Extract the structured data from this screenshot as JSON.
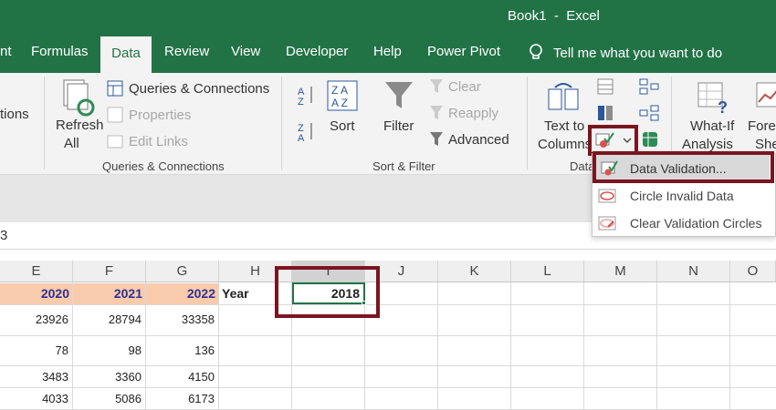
{
  "app": {
    "title": "Book1  -  Excel"
  },
  "tabs": [
    {
      "label": "nt"
    },
    {
      "label": "Formulas"
    },
    {
      "label": "Data"
    },
    {
      "label": "Review"
    },
    {
      "label": "View"
    },
    {
      "label": "Developer"
    },
    {
      "label": "Help"
    },
    {
      "label": "Power Pivot"
    }
  ],
  "tell_me": "Tell me what you want to do",
  "ribbon": {
    "left_cut": "tions",
    "refresh": {
      "line1": "Refresh",
      "line2": "All"
    },
    "queries_connections": "Queries & Connections",
    "properties": "Properties",
    "edit_links": "Edit Links",
    "group_queries": "Queries & Connections",
    "sort": "Sort",
    "filter": "Filter",
    "clear": "Clear",
    "reapply": "Reapply",
    "advanced": "Advanced",
    "group_sort_filter": "Sort & Filter",
    "text_to_columns": {
      "line1": "Text to",
      "line2": "Columns"
    },
    "group_data_tools": "Data",
    "whatif": {
      "line1": "What-If",
      "line2": "Analysis"
    },
    "forecast": {
      "line1": "Forec",
      "line2": "She"
    }
  },
  "menu": {
    "items": [
      {
        "label": "Data Validation...",
        "highlighted": true,
        "enabled": true
      },
      {
        "label": "Circle Invalid Data",
        "highlighted": false,
        "enabled": true
      },
      {
        "label": "Clear Validation Circles",
        "highlighted": false,
        "enabled": true
      }
    ]
  },
  "name_box_partial": "3",
  "grid": {
    "columns": [
      "E",
      "F",
      "G",
      "H",
      "I",
      "J",
      "K",
      "L",
      "M",
      "N",
      "O"
    ],
    "header_row": {
      "E": "2020",
      "F": "2021",
      "G": "2022",
      "H": "Year",
      "I": "2018"
    },
    "rows": [
      {
        "E": "23926",
        "F": "28794",
        "G": "33358"
      },
      {
        "E": "78",
        "F": "98",
        "G": "136"
      },
      {
        "E": "3483",
        "F": "3360",
        "G": "4150"
      },
      {
        "E": "4033",
        "F": "5086",
        "G": "6173"
      }
    ]
  },
  "colors": {
    "excel_green": "#217346",
    "highlight_red": "#7b1520",
    "header_fill": "#f8cbad",
    "header_text": "#2e3192"
  }
}
